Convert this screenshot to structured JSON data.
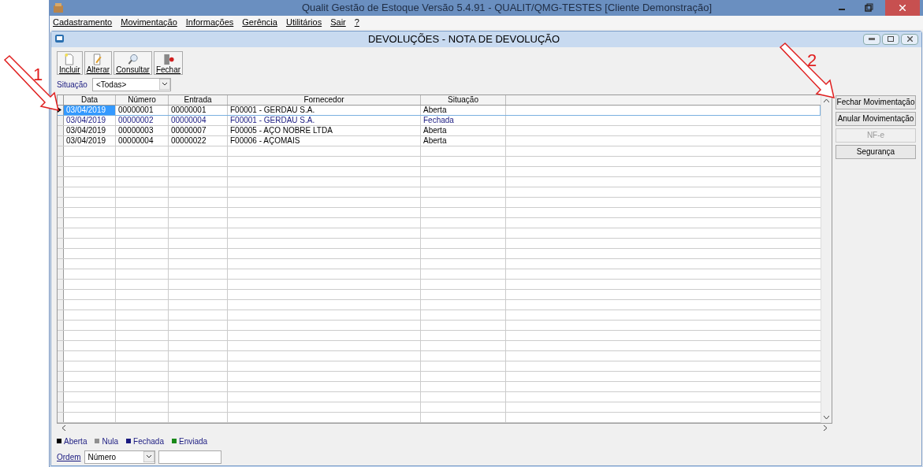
{
  "app_window": {
    "title": "Qualit Gestão de Estoque Versão 5.4.91 - QUALIT/QMG-TESTES [Cliente Demonstração]"
  },
  "menu": [
    "Cadastramento",
    "Movimentação",
    "Informações",
    "Gerência",
    "Utilitários",
    "Sair",
    "?"
  ],
  "child_window": {
    "title": "DEVOLUÇÕES - NOTA DE DEVOLUÇÃO"
  },
  "toolbar": [
    {
      "label": "Incluir",
      "kind": "new"
    },
    {
      "label": "Alterar",
      "kind": "edit"
    },
    {
      "label": "Consultar",
      "kind": "search"
    },
    {
      "label": "Fechar",
      "kind": "exit"
    }
  ],
  "filter": {
    "label": "Situação",
    "value": "<Todas>"
  },
  "table": {
    "columns": [
      "Data",
      "Número",
      "Entrada",
      "Fornecedor",
      "Situação"
    ],
    "rows": [
      {
        "cells": [
          "03/04/2019",
          "00000001",
          "00000001",
          "F00001 - GERDAU S.A.",
          "Aberta"
        ],
        "selected": true,
        "color": "#000000"
      },
      {
        "cells": [
          "03/04/2019",
          "00000002",
          "00000004",
          "F00001 - GERDAU S.A.",
          "Fechada"
        ],
        "selected": false,
        "color": "#1a1a80"
      },
      {
        "cells": [
          "03/04/2019",
          "00000003",
          "00000007",
          "F00005 - AÇO NOBRE LTDA",
          "Aberta"
        ],
        "selected": false,
        "color": "#000000"
      },
      {
        "cells": [
          "03/04/2019",
          "00000004",
          "00000022",
          "F00006 - AÇOMAIS",
          "Aberta"
        ],
        "selected": false,
        "color": "#000000"
      }
    ]
  },
  "side_buttons": [
    {
      "label": "Fechar Movimentação",
      "disabled": false
    },
    {
      "label": "Anular Movimentação",
      "disabled": false
    },
    {
      "label": "NF-e",
      "disabled": true
    },
    {
      "label": "Segurança",
      "disabled": false
    }
  ],
  "legend": [
    {
      "label": "Aberta",
      "color": "#000000"
    },
    {
      "label": "Nula",
      "color": "#909090"
    },
    {
      "label": "Fechada",
      "color": "#1a1a80"
    },
    {
      "label": "Enviada",
      "color": "#1a8a1a"
    }
  ],
  "order": {
    "label": "Ordem",
    "value": "Número"
  },
  "annotations": [
    "1",
    "2"
  ]
}
